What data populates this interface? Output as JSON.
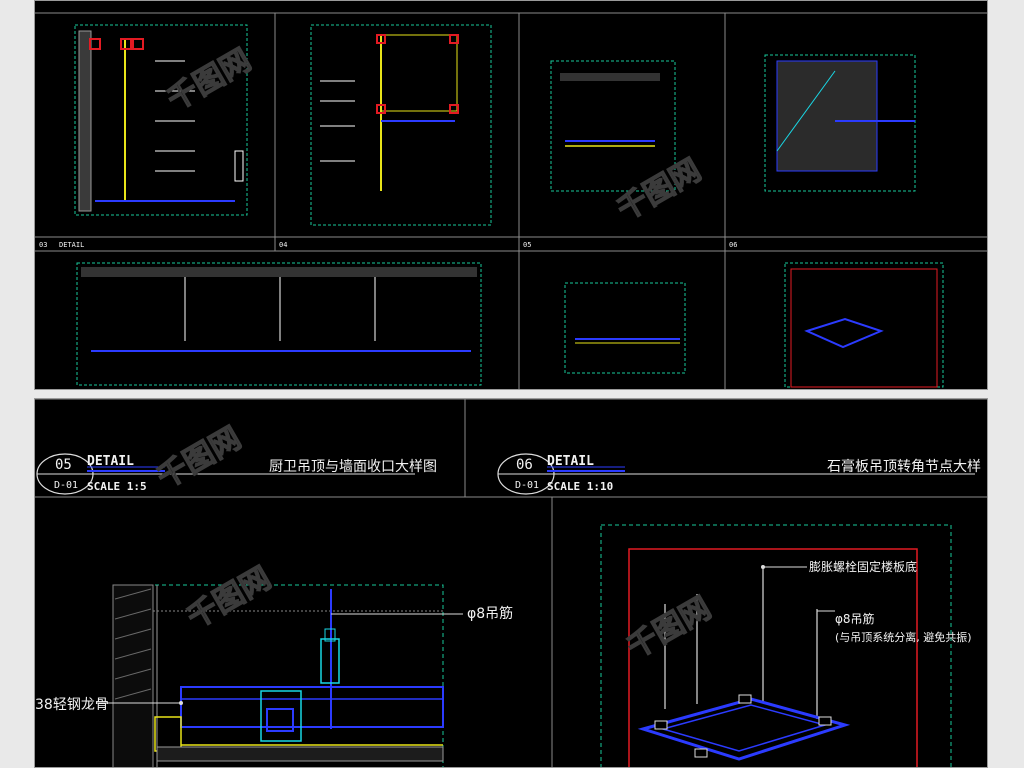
{
  "bottom": {
    "left_panel": {
      "number": "05",
      "sheet_ref": "D-01",
      "detail_label": "DETAIL",
      "scale_label": "SCALE 1:5",
      "title": "厨卫吊顶与墙面收口大样图",
      "annotations": {
        "rod": "φ8吊筋",
        "keel": "38轻钢龙骨"
      }
    },
    "right_panel": {
      "number": "06",
      "sheet_ref": "D-01",
      "detail_label": "DETAIL",
      "scale_label": "SCALE 1:10",
      "title": "石膏板吊顶转角节点大样",
      "annotations": {
        "anchor": "膨胀螺栓固定楼板底",
        "rod": "φ8吊筋",
        "rod_note": "(与吊顶系统分离, 避免共振)"
      }
    }
  },
  "top": {
    "row1_labels": [
      "03",
      "04",
      "05",
      "06"
    ],
    "row1_detail": "DETAIL"
  },
  "colors": {
    "background": "#000000",
    "line_blue": "#2b3bff",
    "line_cyan": "#19d8e6",
    "line_yellow": "#e9e419",
    "line_red": "#e31b23",
    "dashed_green": "#18c89a",
    "frame_gray": "#7a7a7a"
  }
}
